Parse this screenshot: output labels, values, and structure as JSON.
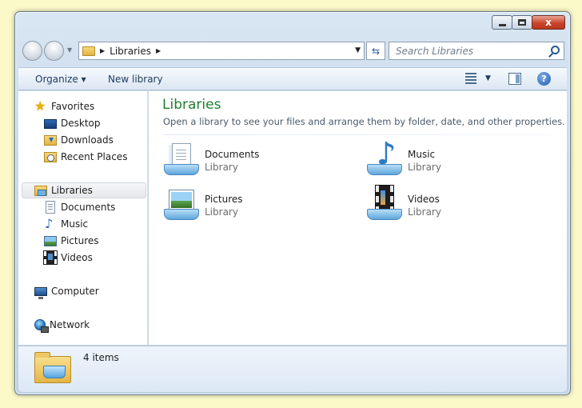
{
  "window": {
    "close_glyph": "x"
  },
  "address": {
    "crumb": "Libraries"
  },
  "search": {
    "placeholder": "Search Libraries"
  },
  "toolbar": {
    "organize_label": "Organize ▾",
    "new_library_label": "New library",
    "help_glyph": "?"
  },
  "navigation": {
    "favorites": "Favorites",
    "favorites_items": [
      "Desktop",
      "Downloads",
      "Recent Places"
    ],
    "libraries": "Libraries",
    "libraries_items": [
      "Documents",
      "Music",
      "Pictures",
      "Videos"
    ],
    "computer": "Computer",
    "network": "Network"
  },
  "content": {
    "title": "Libraries",
    "subtitle": "Open a library to see your files and arrange them by folder, date, and other properties.",
    "items": [
      {
        "name": "Documents",
        "type": "Library",
        "icon": "documents-library-icon"
      },
      {
        "name": "Music",
        "type": "Library",
        "icon": "music-library-icon"
      },
      {
        "name": "Pictures",
        "type": "Library",
        "icon": "pictures-library-icon"
      },
      {
        "name": "Videos",
        "type": "Library",
        "icon": "videos-library-icon"
      }
    ]
  },
  "details": {
    "item_count": "4 items"
  },
  "colors": {
    "title_green": "#1e7e2e",
    "background": "#fbf9c8"
  }
}
